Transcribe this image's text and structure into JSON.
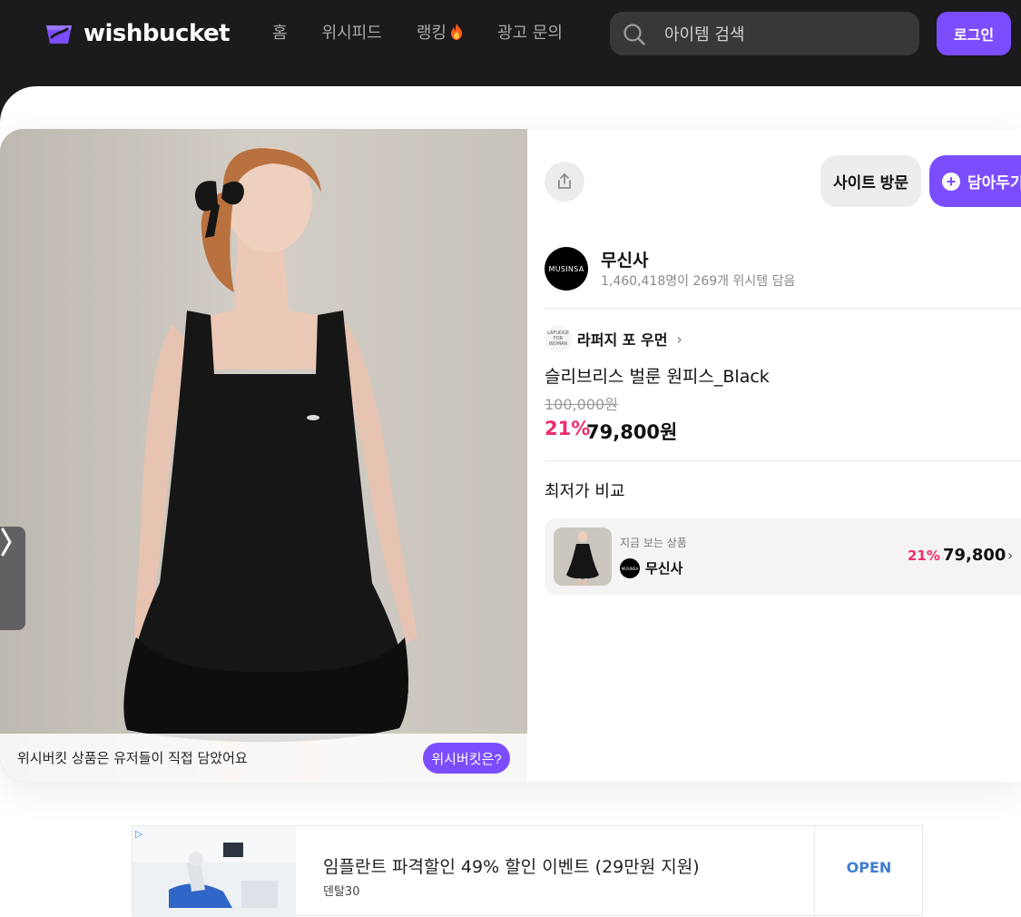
{
  "header": {
    "logo_text": "wishbucket",
    "nav": [
      {
        "label": "홈"
      },
      {
        "label": "위시피드"
      },
      {
        "label": "랭킹"
      },
      {
        "label": "광고 문의"
      }
    ],
    "ranking_icon": "fire-icon",
    "search_placeholder": "아이템 검색",
    "login_label": "로그인"
  },
  "photo": {
    "footer_text": "위시버킷 상품은 유저들이 직접 담았어요",
    "what_button": "위시버킷은?",
    "next_icon": "chevron-right-icon"
  },
  "actions": {
    "share_icon": "share-icon",
    "visit_label": "사이트 방문",
    "save_label": "담아두기"
  },
  "shop": {
    "logo_text": "MUSINSA",
    "name": "무신사",
    "stats": "1,460,418명이 269개 위시템 담음"
  },
  "product": {
    "brand_logo_text": "LAFUDGE FOR WOMAN",
    "brand": "라퍼지 포 우먼",
    "title": "슬리브리스 벌룬 원피스_Black",
    "original_price": "100,000원",
    "discount": "21%",
    "price": "79,800원"
  },
  "compare": {
    "title": "최저가 비교",
    "items": [
      {
        "label": "지금 보는 상품",
        "shop": "무신사",
        "shop_logo_text": "MUSINSA",
        "discount": "21%",
        "price": "79,800"
      }
    ]
  },
  "ad": {
    "mark": "▷",
    "title": "임플란트 파격할인 49% 할인 이벤트 (29만원 지원)",
    "sponsor": "덴탈30",
    "cta": "OPEN"
  },
  "colors": {
    "accent": "#7c4dff",
    "discount": "#ee2d6a",
    "header_bg": "#1b1a1c"
  }
}
